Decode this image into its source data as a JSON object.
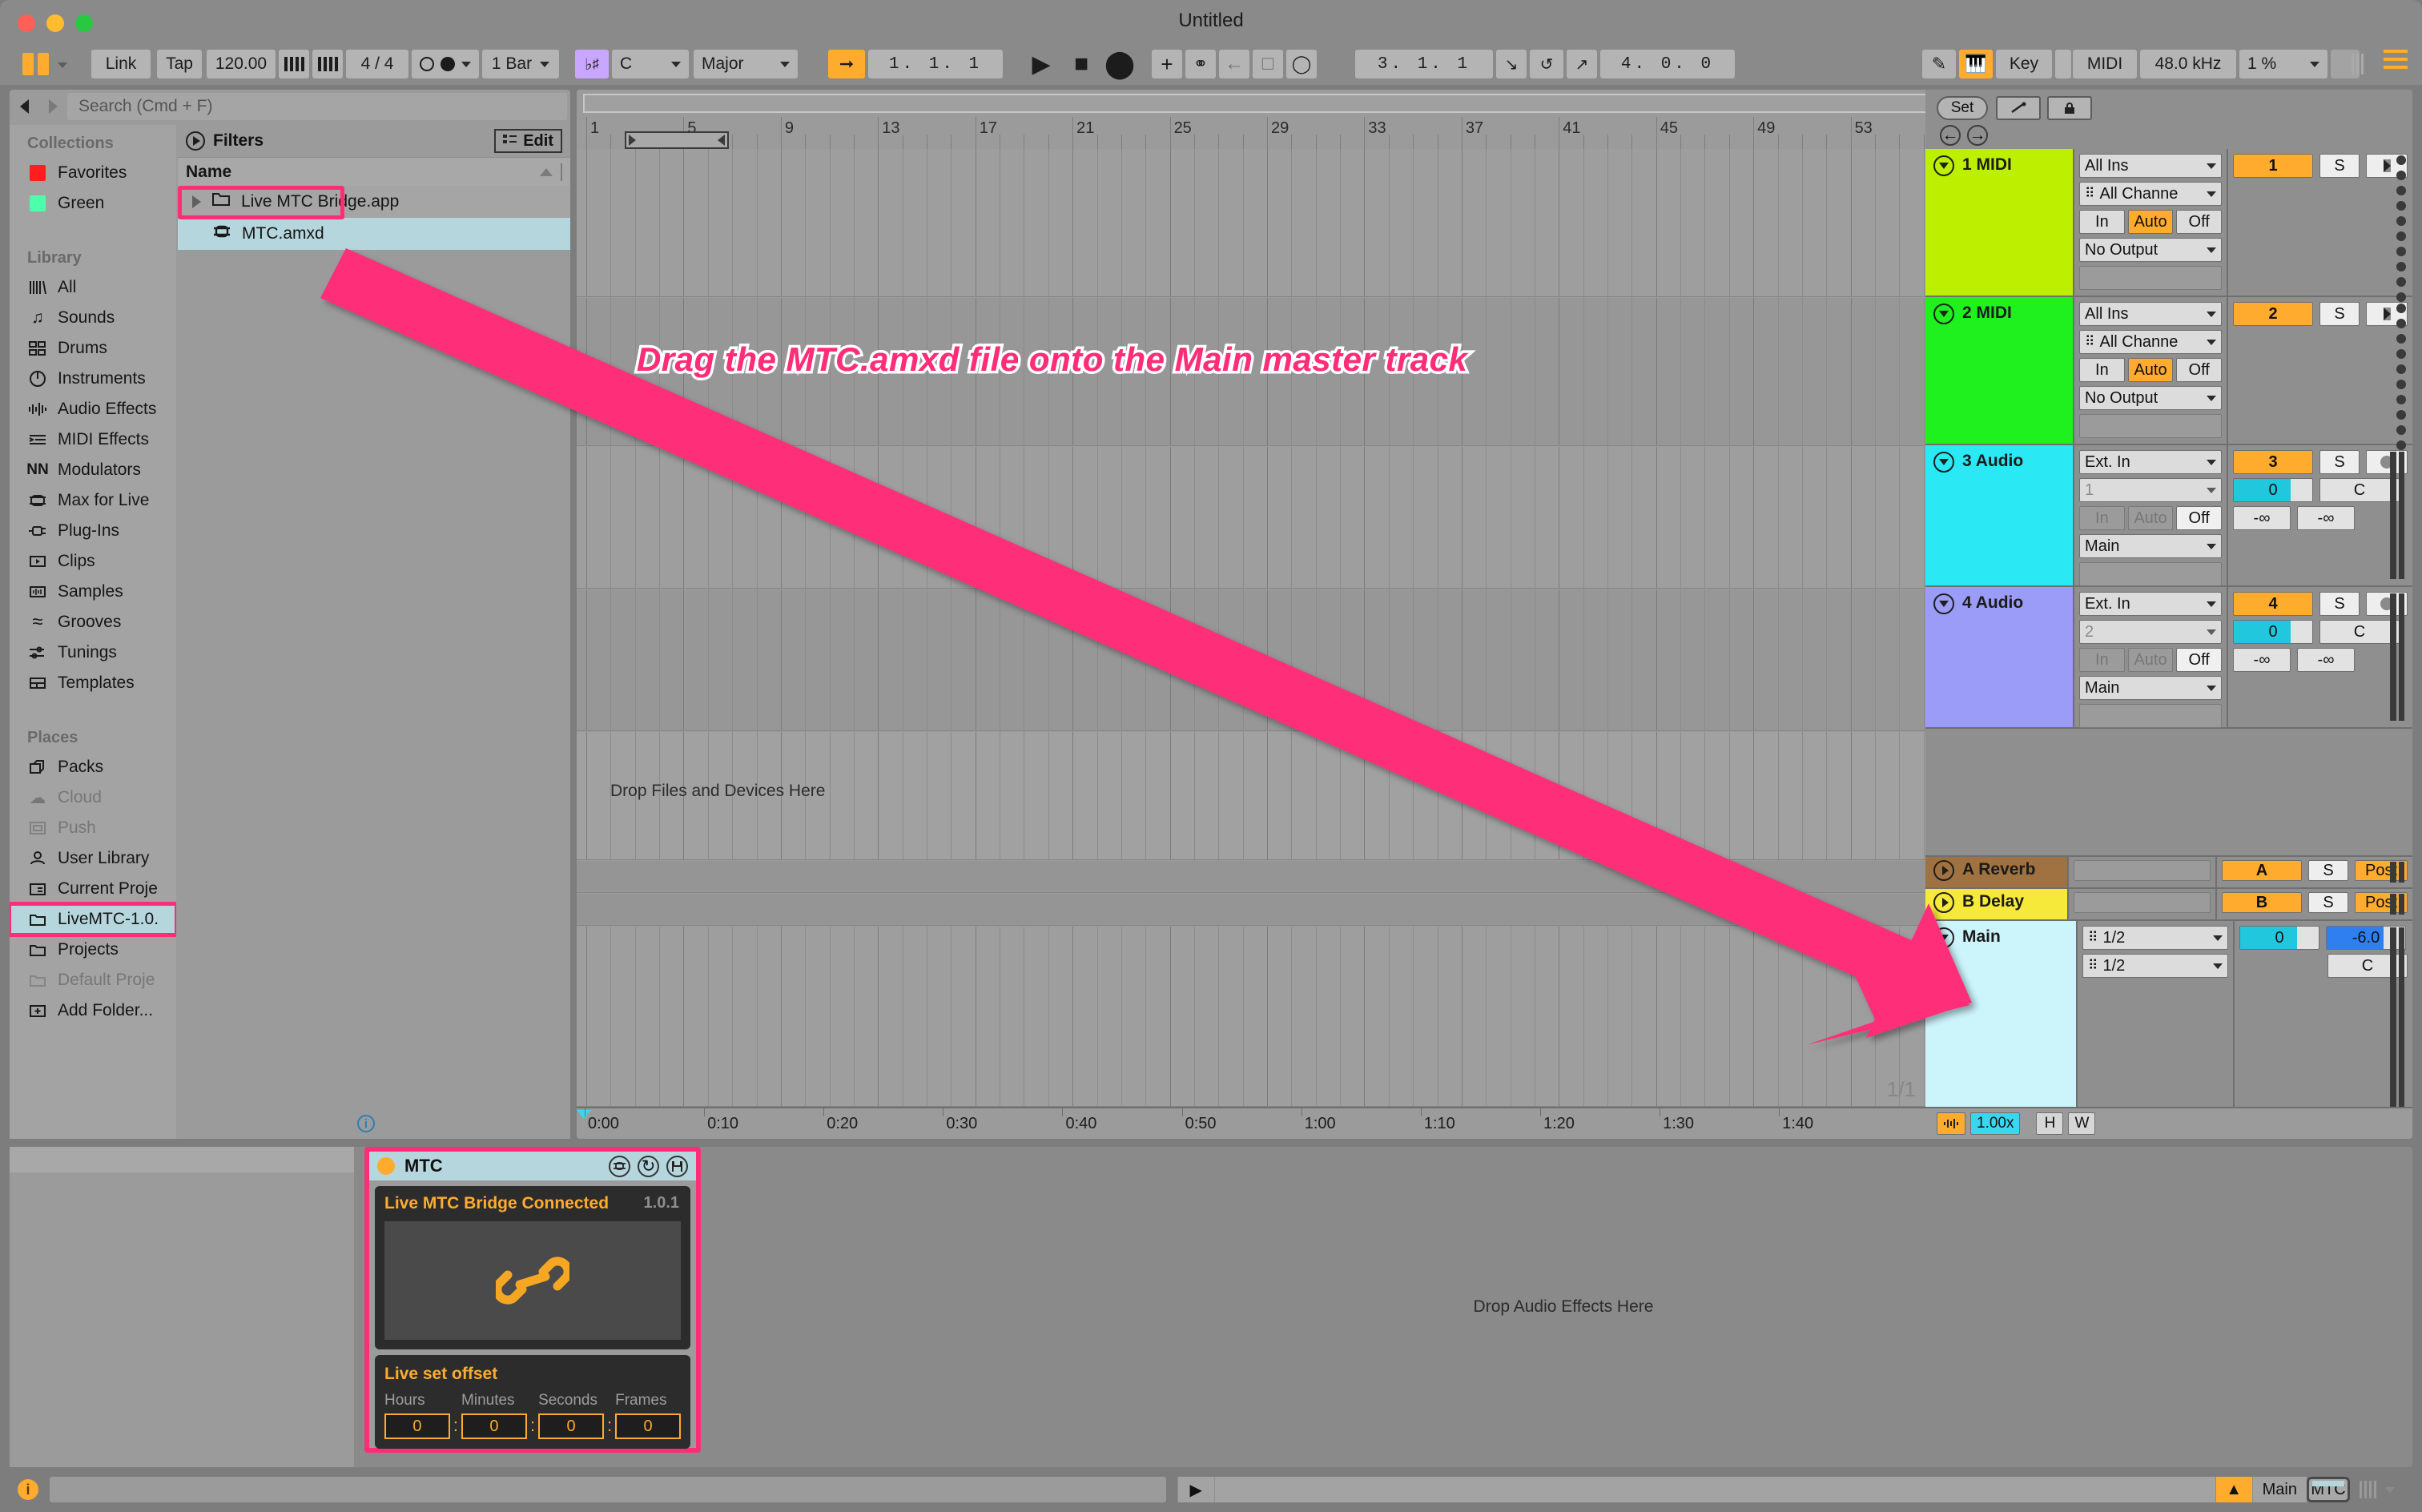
{
  "window": {
    "title": "Untitled"
  },
  "controlbar": {
    "link": "Link",
    "tap": "Tap",
    "tempo": "120.00",
    "time_signature": "4 / 4",
    "quantize": "1 Bar",
    "key_root": "C",
    "key_scale": "Major",
    "arrangement_position": "1. 1. 1",
    "loop_start": "3. 1. 1",
    "loop_length": "4. 0. 0",
    "key_label": "Key",
    "midi_label": "MIDI",
    "sample_rate": "48.0 kHz",
    "cpu_load": "1 %"
  },
  "browser": {
    "search_placeholder": "Search (Cmd + F)",
    "collections_header": "Collections",
    "collections": [
      {
        "label": "Favorites",
        "color": "#ff1d1d"
      },
      {
        "label": "Green",
        "color": "#4dffaa"
      }
    ],
    "library_header": "Library",
    "library": [
      {
        "label": "All",
        "icon": "bars-icon"
      },
      {
        "label": "Sounds",
        "icon": "note-icon"
      },
      {
        "label": "Drums",
        "icon": "grid-icon"
      },
      {
        "label": "Instruments",
        "icon": "clock-icon"
      },
      {
        "label": "Audio Effects",
        "icon": "waveform-icon"
      },
      {
        "label": "MIDI Effects",
        "icon": "lines-icon"
      },
      {
        "label": "Modulators",
        "icon": "nn-icon"
      },
      {
        "label": "Max for Live",
        "icon": "max-icon"
      },
      {
        "label": "Plug-Ins",
        "icon": "plug-icon"
      },
      {
        "label": "Clips",
        "icon": "clip-icon"
      },
      {
        "label": "Samples",
        "icon": "sample-icon"
      },
      {
        "label": "Grooves",
        "icon": "wave-icon"
      },
      {
        "label": "Tunings",
        "icon": "tuning-icon"
      },
      {
        "label": "Templates",
        "icon": "template-icon"
      }
    ],
    "places_header": "Places",
    "places": [
      {
        "label": "Packs",
        "icon": "packs-icon",
        "dim": false,
        "selected": false
      },
      {
        "label": "Cloud",
        "icon": "cloud-icon",
        "dim": true,
        "selected": false
      },
      {
        "label": "Push",
        "icon": "push-icon",
        "dim": true,
        "selected": false
      },
      {
        "label": "User Library",
        "icon": "user-icon",
        "dim": false,
        "selected": false
      },
      {
        "label": "Current Proje",
        "icon": "project-icon",
        "dim": false,
        "selected": false
      },
      {
        "label": "LiveMTC-1.0.",
        "icon": "folder-icon",
        "dim": false,
        "selected": true
      },
      {
        "label": "Projects",
        "icon": "folder-icon",
        "dim": false,
        "selected": false
      },
      {
        "label": "Default Proje",
        "icon": "folder-icon",
        "dim": true,
        "selected": false
      },
      {
        "label": "Add Folder...",
        "icon": "add-folder-icon",
        "dim": false,
        "selected": false
      }
    ],
    "filters_label": "Filters",
    "edit_label": "Edit",
    "name_column": "Name",
    "files": [
      {
        "label": "Live MTC Bridge.app",
        "type": "folder",
        "selected": false
      },
      {
        "label": "MTC.amxd",
        "type": "max-device",
        "selected": true
      }
    ]
  },
  "arrangement": {
    "bar_numbers": [
      "1",
      "5",
      "9",
      "13",
      "17",
      "21",
      "25",
      "29",
      "33",
      "37",
      "41",
      "45",
      "49",
      "53"
    ],
    "time_labels": [
      "0:00",
      "0:10",
      "0:20",
      "0:30",
      "0:40",
      "0:50",
      "1:00",
      "1:10",
      "1:20",
      "1:30",
      "1:40"
    ],
    "drop_files_message": "Drop Files and Devices Here",
    "zoom_scale": "1/1",
    "set_label": "Set",
    "zoom_value": "1.00x",
    "height_label": "H",
    "width_label": "W"
  },
  "tracks": [
    {
      "name": "1 MIDI",
      "color": "#bdf000",
      "type": "midi",
      "input": "All Ins",
      "channel": "All Channe",
      "monitor": "Auto",
      "output": "No Output",
      "arm": "1",
      "solo": "S"
    },
    {
      "name": "2 MIDI",
      "color": "#1ef11e",
      "type": "midi",
      "input": "All Ins",
      "channel": "All Channe",
      "monitor": "Auto",
      "output": "No Output",
      "arm": "2",
      "solo": "S"
    },
    {
      "name": "3 Audio",
      "color": "#2ae9f5",
      "type": "audio",
      "input": "Ext. In",
      "channel": "1",
      "monitor": "Off",
      "output": "Main",
      "arm": "3",
      "solo": "S",
      "volume": "0",
      "pan": "C",
      "peak_left": "-∞",
      "peak_right": "-∞"
    },
    {
      "name": "4 Audio",
      "color": "#9a9cf7",
      "type": "audio",
      "input": "Ext. In",
      "channel": "2",
      "monitor": "Off",
      "output": "Main",
      "arm": "4",
      "solo": "S",
      "volume": "0",
      "pan": "C",
      "peak_left": "-∞",
      "peak_right": "-∞"
    }
  ],
  "returns": [
    {
      "name": "A Reverb",
      "color": "#a07242",
      "arm": "A",
      "solo": "S",
      "post": "Post"
    },
    {
      "name": "B Delay",
      "color": "#f7e93a",
      "arm": "B",
      "solo": "S",
      "post": "Post"
    }
  ],
  "main_track": {
    "name": "Main",
    "color": "#ccf4fb",
    "out_a": "1/2",
    "out_b": "1/2",
    "volume": "0",
    "gain": "-6.0",
    "pan": "C"
  },
  "annotation": {
    "text": "Drag the MTC.amxd file onto the Main master track",
    "color": "#ff2d78",
    "outline": "#ffffff"
  },
  "device": {
    "title": "MTC",
    "status": "Live MTC Bridge Connected",
    "version": "1.0.1",
    "offset_header": "Live set offset",
    "offset_fields": [
      {
        "label": "Hours",
        "value": "0"
      },
      {
        "label": "Minutes",
        "value": "0"
      },
      {
        "label": "Seconds",
        "value": "0"
      },
      {
        "label": "Frames",
        "value": "0"
      }
    ],
    "drop_audio_message": "Drop Audio Effects Here"
  },
  "statusbar": {
    "main_label": "Main",
    "mtc_label": "MTC"
  }
}
